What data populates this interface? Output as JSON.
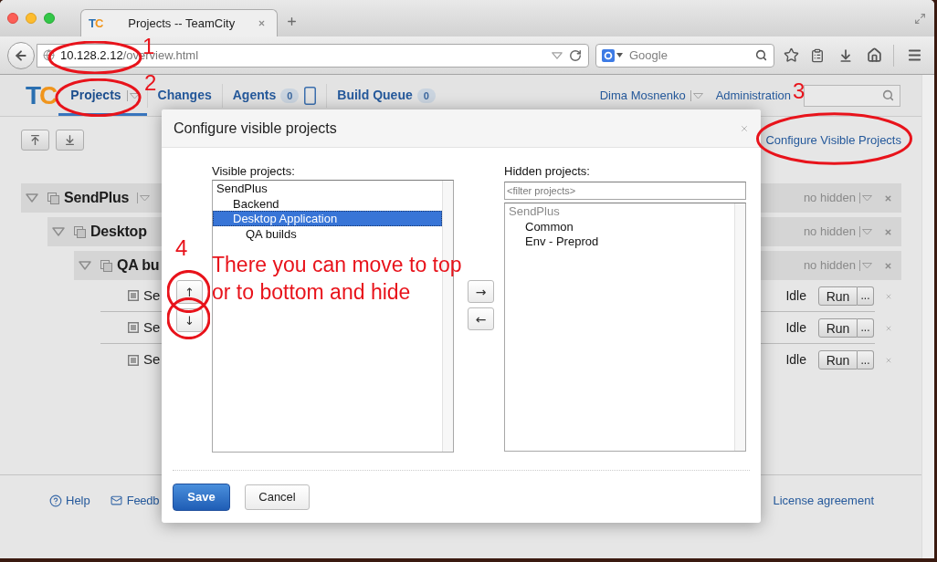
{
  "browser": {
    "tab": {
      "logo": "TC",
      "title": "Projects -- TeamCity"
    },
    "address": {
      "host": "10.128.2.12",
      "path": "/overview.html"
    },
    "search": {
      "placeholder": "Google"
    }
  },
  "header": {
    "logo": "TC",
    "nav": [
      {
        "label": "Projects",
        "selected": true,
        "menu": true,
        "device_icon": false
      },
      {
        "label": "Changes",
        "selected": false,
        "menu": false,
        "device_icon": false
      },
      {
        "label": "Agents",
        "selected": false,
        "menu": false,
        "badge": "0",
        "device_icon": true
      },
      {
        "label": "Build Queue",
        "selected": false,
        "menu": false,
        "badge": "0",
        "device_icon": false
      }
    ],
    "user": "Dima Mosnenko",
    "admin_link": "Administration"
  },
  "page": {
    "configure_link": "Configure Visible Projects",
    "projects": [
      {
        "kind": "project",
        "name": "SendPlus",
        "expanded": true,
        "menu": true,
        "hidden_info": "no hidden",
        "children": [
          {
            "kind": "project",
            "name": "Desktop",
            "expanded": true,
            "menu": false,
            "hidden_info": "no hidden",
            "children": [
              {
                "kind": "project",
                "name": "QA bu",
                "expanded": true,
                "menu": false,
                "hidden_info": "no hidden",
                "children": [
                  {
                    "kind": "build",
                    "name": "Se",
                    "status": "Idle",
                    "run": "Run",
                    "more": "..."
                  },
                  {
                    "kind": "build",
                    "name": "Se",
                    "status": "Idle",
                    "run": "Run",
                    "more": "..."
                  },
                  {
                    "kind": "build",
                    "name": "Se",
                    "status": "Idle",
                    "run": "Run",
                    "more": "..."
                  }
                ]
              }
            ]
          }
        ]
      }
    ],
    "footer": {
      "links": [
        {
          "kind": "help",
          "label": "Help"
        },
        {
          "kind": "feedback",
          "label": "Feedb"
        }
      ],
      "license": "License agreement"
    }
  },
  "dialog": {
    "title": "Configure visible projects",
    "visible": {
      "label": "Visible projects:",
      "items": [
        {
          "name": "SendPlus",
          "selected": false,
          "children": [
            {
              "name": "Backend",
              "selected": false
            },
            {
              "name": "Desktop Application",
              "selected": true,
              "children": [
                {
                  "name": "QA builds",
                  "selected": false
                }
              ]
            }
          ]
        }
      ]
    },
    "order_buttons": [
      "↑",
      "↓"
    ],
    "move_buttons": [
      "→",
      "←"
    ],
    "hidden": {
      "label": "Hidden projects:",
      "filter_placeholder": "<filter projects>",
      "items": [
        {
          "name": "SendPlus",
          "disabled": true,
          "children": [
            {
              "name": "Common",
              "disabled": false
            },
            {
              "name": "Env - Preprod",
              "disabled": false
            }
          ]
        }
      ]
    },
    "buttons": [
      {
        "kind": "primary",
        "label": "Save"
      },
      {
        "kind": "secondary",
        "label": "Cancel"
      }
    ]
  },
  "annotations": {
    "markers": [
      "1",
      "2",
      "3",
      "4"
    ],
    "note": "There you can move to top or to bottom and hide"
  }
}
